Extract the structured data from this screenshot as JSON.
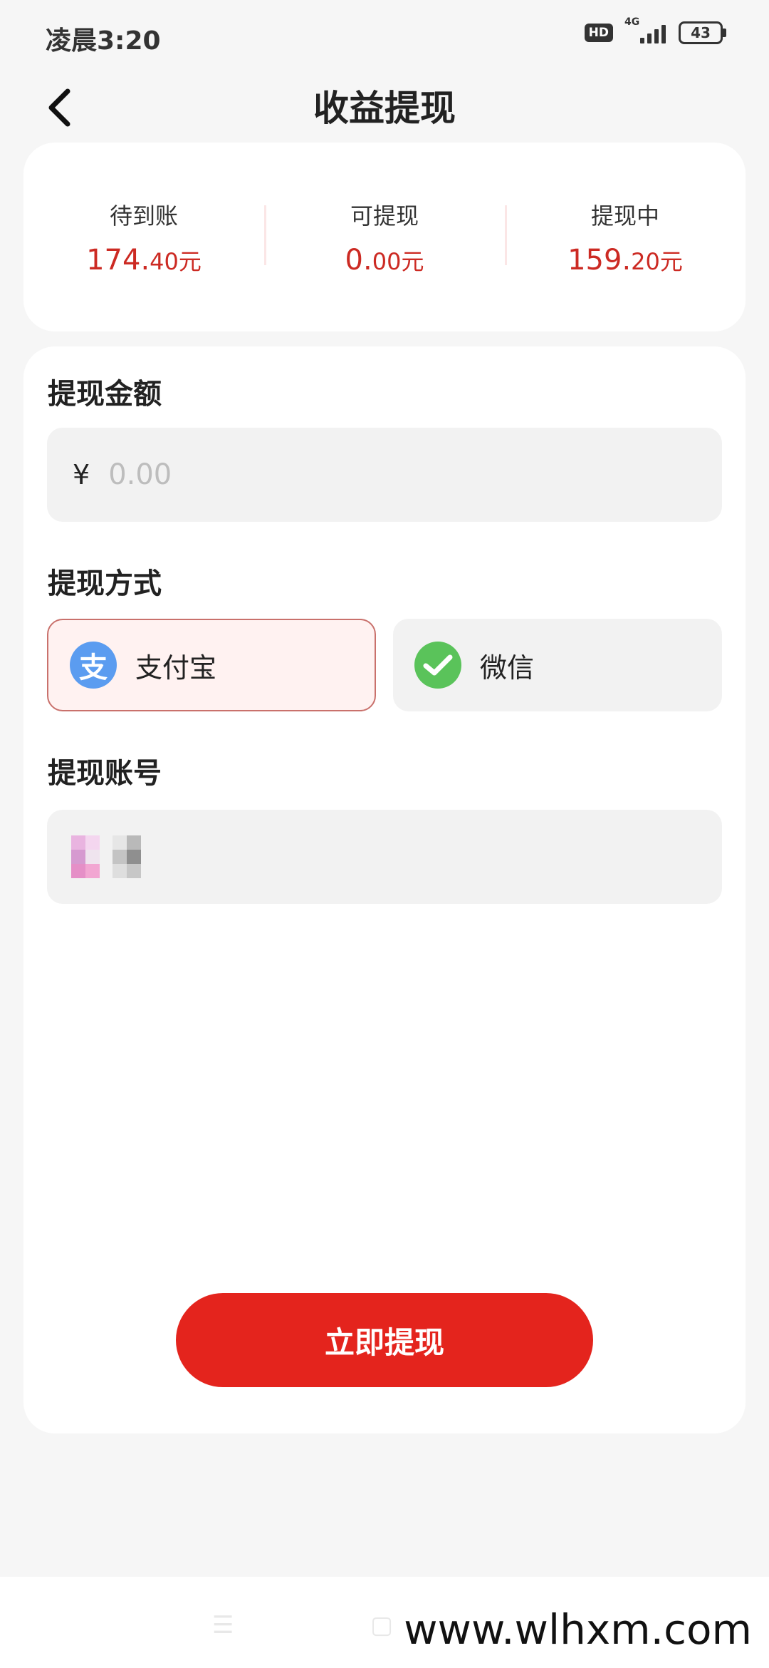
{
  "status_bar": {
    "time": "凌晨3:20",
    "hd": "HD",
    "network": "4G",
    "battery": "43"
  },
  "header": {
    "title": "收益提现"
  },
  "summary": [
    {
      "label": "待到账",
      "int": "174.",
      "dec": "40元"
    },
    {
      "label": "可提现",
      "int": "0.",
      "dec": "00元"
    },
    {
      "label": "提现中",
      "int": "159.",
      "dec": "20元"
    }
  ],
  "form": {
    "amount_label": "提现金额",
    "currency_symbol": "¥",
    "amount_placeholder": "0.00",
    "method_label": "提现方式",
    "methods": [
      {
        "name": "支付宝",
        "icon": "alipay-icon",
        "icon_glyph": "支",
        "selected": true
      },
      {
        "name": "微信",
        "icon": "wechat-icon",
        "selected": false
      }
    ],
    "account_label": "提现账号",
    "submit_label": "立即提现"
  },
  "colors": {
    "accent_red": "#e4241d",
    "amount_red": "#cc2a23",
    "alipay_blue": "#5b9cf0",
    "wechat_green": "#5ac35a"
  },
  "watermark": "www.wlhxm.com"
}
